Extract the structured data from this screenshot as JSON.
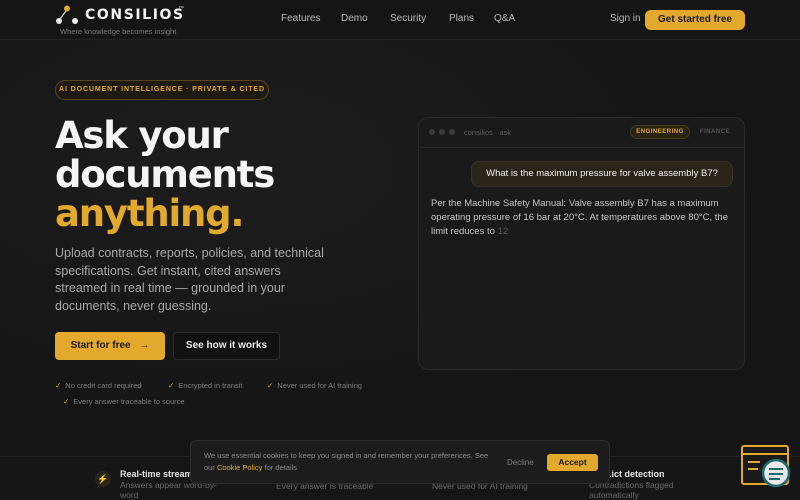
{
  "brand": {
    "name": "CONSILIOS",
    "tm": "™",
    "tagline": "Where knowledge becomes insight"
  },
  "nav": {
    "links": [
      "Features",
      "Demo",
      "Security",
      "Plans",
      "Q&A"
    ],
    "sign_in": "Sign in",
    "cta": "Get started free"
  },
  "hero": {
    "badge": "AI DOCUMENT INTELLIGENCE · PRIVATE & CITED",
    "title_lines": [
      "Ask your",
      "documents"
    ],
    "title_accent": "anything.",
    "description": "Upload contracts, reports, policies, and technical specifications. Get instant, cited answers streamed in real time — grounded in your documents, never guessing.",
    "primary_cta": "Start for free",
    "primary_cta_arrow": "→",
    "secondary_cta": "See how it works",
    "checks": [
      "No credit card required",
      "Encrypted in transit",
      "Never used for AI training",
      "Every answer traceable to source"
    ]
  },
  "chat": {
    "title": "consilios · ask",
    "tags": [
      "ENGINEERING",
      "FINANCE"
    ],
    "active_tag": "ENGINEERING",
    "user_message": "What is the maximum pressure for valve assembly B7?",
    "bot_message": "Per the Machine Safety Manual: Valve assembly B7 has a maximum operating pressure of 16 bar at 20°C. At temperatures above 80°C, the limit reduces to",
    "bot_streaming": "12"
  },
  "features": [
    {
      "title": "Real-time stream",
      "subtitle": "Answers appear word-by-word"
    },
    {
      "title": "",
      "subtitle": "Every answer is traceable"
    },
    {
      "title": "",
      "subtitle": "Never used for AI training"
    },
    {
      "title": "...ict detection",
      "subtitle": "Contradictions flagged automatically"
    }
  ],
  "cookie": {
    "text_before": "We use essential cookies to keep you signed in and remember your preferences. See our",
    "link": "Cookie Policy",
    "text_after": "for details",
    "decline": "Decline",
    "accept": "Accept"
  },
  "colors": {
    "accent": "#e3a92d",
    "background": "#151515",
    "panel": "#1a1a1a"
  },
  "icons": {
    "feature": "lightning-icon",
    "check": "checkmark-icon",
    "widget": "chat-support-icon"
  }
}
